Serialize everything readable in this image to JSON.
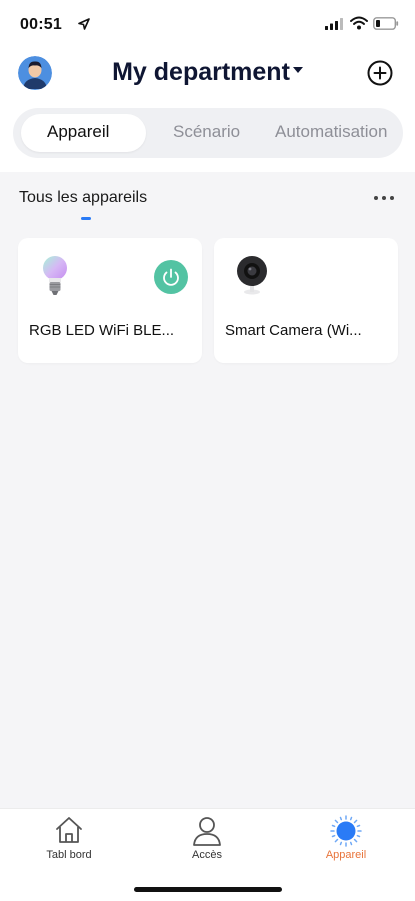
{
  "status_bar": {
    "time": "00:51",
    "icons": [
      "location-arrow-icon",
      "signal-icon",
      "wifi-icon",
      "battery-icon"
    ]
  },
  "header": {
    "avatar_icon": "user-avatar",
    "title": "My department",
    "title_caret_icon": "caret-down-icon",
    "add_icon": "add-circle-icon"
  },
  "segments": {
    "active_index": 0,
    "items": [
      {
        "label": "Appareil"
      },
      {
        "label": "Scénario"
      },
      {
        "label": "Automatisation"
      }
    ]
  },
  "section": {
    "title": "Tous les appareils",
    "more_icon": "more-dots-icon",
    "accent_color": "#2a7bf6"
  },
  "devices": [
    {
      "name": "RGB LED WiFi BLE...",
      "icon": "bulb-icon",
      "has_power_button": true,
      "power_color": "#53c3a3"
    },
    {
      "name": "Smart Camera (Wi...",
      "icon": "camera-icon",
      "has_power_button": false
    }
  ],
  "tab_bar": {
    "active_index": 2,
    "active_color": "#e8743b",
    "items": [
      {
        "label": "Tabl bord",
        "icon": "home-icon"
      },
      {
        "label": "Accès",
        "icon": "person-icon"
      },
      {
        "label": "Appareil",
        "icon": "device-sun-icon"
      }
    ]
  }
}
